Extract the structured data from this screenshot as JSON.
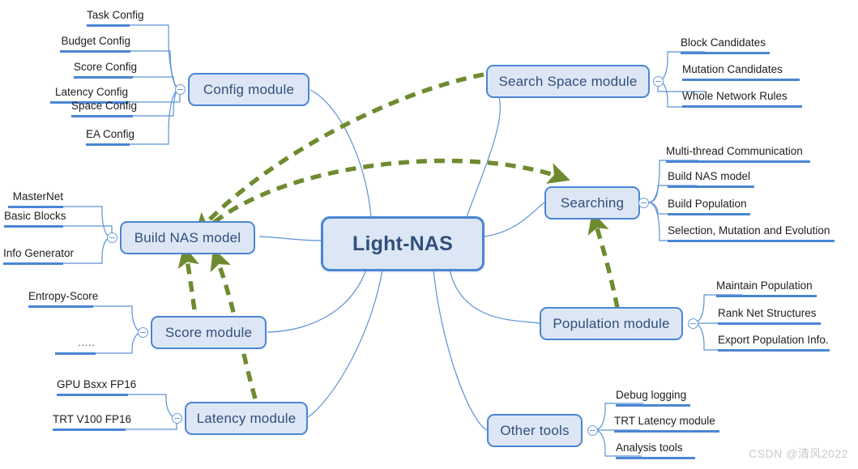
{
  "diagram": {
    "title": "Light-NAS",
    "type": "mind-map",
    "colors": {
      "node_fill": "#dde6f4",
      "node_border": "#4a86d4",
      "node_text": "#31507d",
      "branch_line": "#5b92d6",
      "leaf_underline": "#4a86d4",
      "dependency_arrow": "#6e8b30",
      "watermark": "#c9c9c9"
    }
  },
  "center": {
    "label": "Light-NAS"
  },
  "modules": [
    {
      "id": "config-module",
      "label": "Config module",
      "side": "left",
      "children": [
        {
          "label": "Task Config"
        },
        {
          "label": "Budget Config"
        },
        {
          "label": "Score Config"
        },
        {
          "label": "Latency Config"
        },
        {
          "label": "Space Config"
        },
        {
          "label": "EA Config"
        }
      ]
    },
    {
      "id": "build-nas-model",
      "label": "Build  NAS model",
      "side": "left",
      "children": [
        {
          "label": "MasterNet"
        },
        {
          "label": "Basic Blocks"
        },
        {
          "label": "Info Generator"
        }
      ]
    },
    {
      "id": "score-module",
      "label": "Score module",
      "side": "left",
      "children": [
        {
          "label": "Entropy-Score"
        },
        {
          "label": "....."
        }
      ]
    },
    {
      "id": "latency-module",
      "label": "Latency module",
      "side": "left",
      "children": [
        {
          "label": "GPU Bsxx FP16"
        },
        {
          "label": "TRT V100 FP16"
        }
      ]
    },
    {
      "id": "search-space-module",
      "label": "Search Space module",
      "side": "right",
      "children": [
        {
          "label": "Block Candidates"
        },
        {
          "label": "Mutation Candidates"
        },
        {
          "label": "Whole Network Rules"
        }
      ]
    },
    {
      "id": "searching",
      "label": "Searching",
      "side": "right",
      "children": [
        {
          "label": "Multi-thread Communication"
        },
        {
          "label": "Build NAS model"
        },
        {
          "label": "Build Population"
        },
        {
          "label": "Selection, Mutation and Evolution"
        }
      ]
    },
    {
      "id": "population-module",
      "label": "Population module",
      "side": "right",
      "children": [
        {
          "label": "Maintain Population"
        },
        {
          "label": "Rank Net Structures"
        },
        {
          "label": "Export Population Info."
        }
      ]
    },
    {
      "id": "other-tools",
      "label": "Other tools",
      "side": "right",
      "children": [
        {
          "label": "Debug logging"
        },
        {
          "label": "TRT Latency module"
        },
        {
          "label": "Analysis tools"
        }
      ]
    }
  ],
  "dependencies": [
    {
      "from": "search-space-module",
      "to": "build-nas-model"
    },
    {
      "from": "build-nas-model",
      "to": "searching"
    },
    {
      "from": "score-module",
      "to": "build-nas-model"
    },
    {
      "from": "latency-module",
      "to": "build-nas-model"
    },
    {
      "from": "population-module",
      "to": "searching"
    }
  ],
  "watermark": {
    "text": "CSDN @清风2022"
  }
}
